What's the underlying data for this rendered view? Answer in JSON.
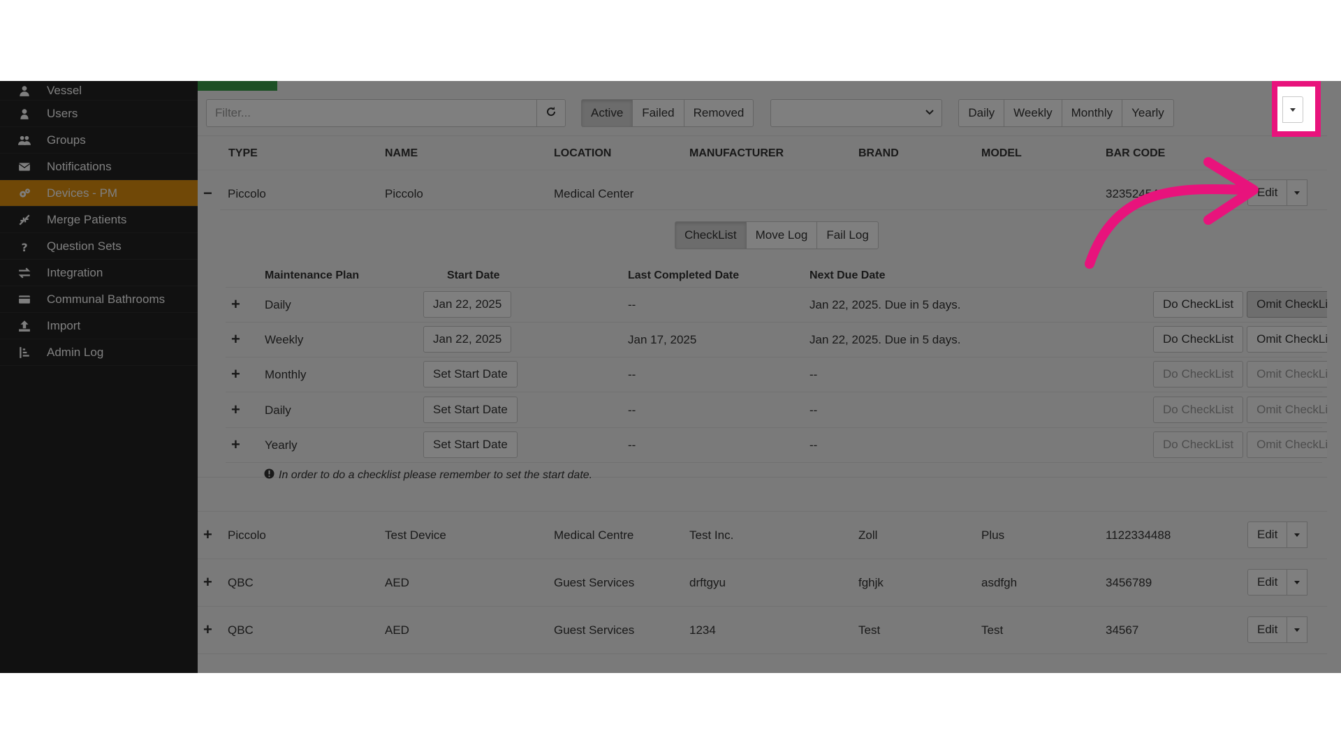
{
  "sidebar": {
    "items": [
      {
        "label": "Vessel",
        "icon": "ship-icon",
        "active": false
      },
      {
        "label": "Users",
        "icon": "user-icon",
        "active": false
      },
      {
        "label": "Groups",
        "icon": "group-icon",
        "active": false
      },
      {
        "label": "Notifications",
        "icon": "envelope-icon",
        "active": false
      },
      {
        "label": "Devices - PM",
        "icon": "gears-icon",
        "active": true
      },
      {
        "label": "Merge Patients",
        "icon": "compress-icon",
        "active": false
      },
      {
        "label": "Question Sets",
        "icon": "question-icon",
        "active": false
      },
      {
        "label": "Integration",
        "icon": "exchange-icon",
        "active": false
      },
      {
        "label": "Communal Bathrooms",
        "icon": "card-icon",
        "active": false
      },
      {
        "label": "Import",
        "icon": "upload-icon",
        "active": false
      },
      {
        "label": "Admin Log",
        "icon": "sort-icon",
        "active": false
      }
    ]
  },
  "toolbar": {
    "filter_placeholder": "Filter...",
    "status_tabs": [
      "Active",
      "Failed",
      "Removed"
    ],
    "active_status": "Active",
    "select_value": "",
    "period_tabs": [
      "Daily",
      "Weekly",
      "Monthly",
      "Yearly"
    ]
  },
  "table": {
    "headers": {
      "type": "TYPE",
      "name": "NAME",
      "location": "LOCATION",
      "manufacturer": "MANUFACTURER",
      "brand": "BRAND",
      "model": "MODEL",
      "barcode": "BAR CODE"
    },
    "expanded": {
      "toggle": "−",
      "type": "Piccolo",
      "name": "Piccolo",
      "location": "Medical Center",
      "manufacturer": "",
      "brand": "",
      "model": "",
      "barcode": "3235245426",
      "edit": "Edit"
    },
    "rows": [
      {
        "toggle": "+",
        "type": "Piccolo",
        "name": "Test Device",
        "location": "Medical Centre",
        "manufacturer": "Test Inc.",
        "brand": "Zoll",
        "model": "Plus",
        "barcode": "1122334488",
        "edit": "Edit"
      },
      {
        "toggle": "+",
        "type": "QBC",
        "name": "AED",
        "location": "Guest Services",
        "manufacturer": "drftgyu",
        "brand": "fghjk",
        "model": "asdfgh",
        "barcode": "3456789",
        "edit": "Edit"
      },
      {
        "toggle": "+",
        "type": "QBC",
        "name": "AED",
        "location": "Guest Services",
        "manufacturer": "1234",
        "brand": "Test",
        "model": "Test",
        "barcode": "34567",
        "edit": "Edit"
      }
    ]
  },
  "detail": {
    "tabs": [
      "CheckList",
      "Move Log",
      "Fail Log"
    ],
    "active_tab": "CheckList",
    "headers": {
      "plan": "Maintenance Plan",
      "start": "Start Date",
      "last": "Last Completed Date",
      "next": "Next Due Date"
    },
    "plans": [
      {
        "plan": "Daily",
        "start": "Jan 22, 2025",
        "last": "--",
        "next": "Jan 22, 2025. Due in 5 days.",
        "do": "Do CheckList",
        "omit": "Omit CheckList",
        "enabled": true
      },
      {
        "plan": "Weekly",
        "start": "Jan 22, 2025",
        "last": "Jan 17, 2025",
        "next": "Jan 22, 2025. Due in 5 days.",
        "do": "Do CheckList",
        "omit": "Omit CheckList",
        "enabled": true
      },
      {
        "plan": "Monthly",
        "start": "Set Start Date",
        "last": "--",
        "next": "--",
        "do": "Do CheckList",
        "omit": "Omit CheckList",
        "enabled": false
      },
      {
        "plan": "Daily",
        "start": "Set Start Date",
        "last": "--",
        "next": "--",
        "do": "Do CheckList",
        "omit": "Omit CheckList",
        "enabled": false
      },
      {
        "plan": "Yearly",
        "start": "Set Start Date",
        "last": "--",
        "next": "--",
        "do": "Do CheckList",
        "omit": "Omit CheckList",
        "enabled": false
      }
    ],
    "note": "In order to do a checklist please remember to set the start date."
  },
  "colors": {
    "accent": "#e0900f",
    "highlight": "#e8137c",
    "sidebar": "#222222",
    "progress": "#3aa14a"
  }
}
